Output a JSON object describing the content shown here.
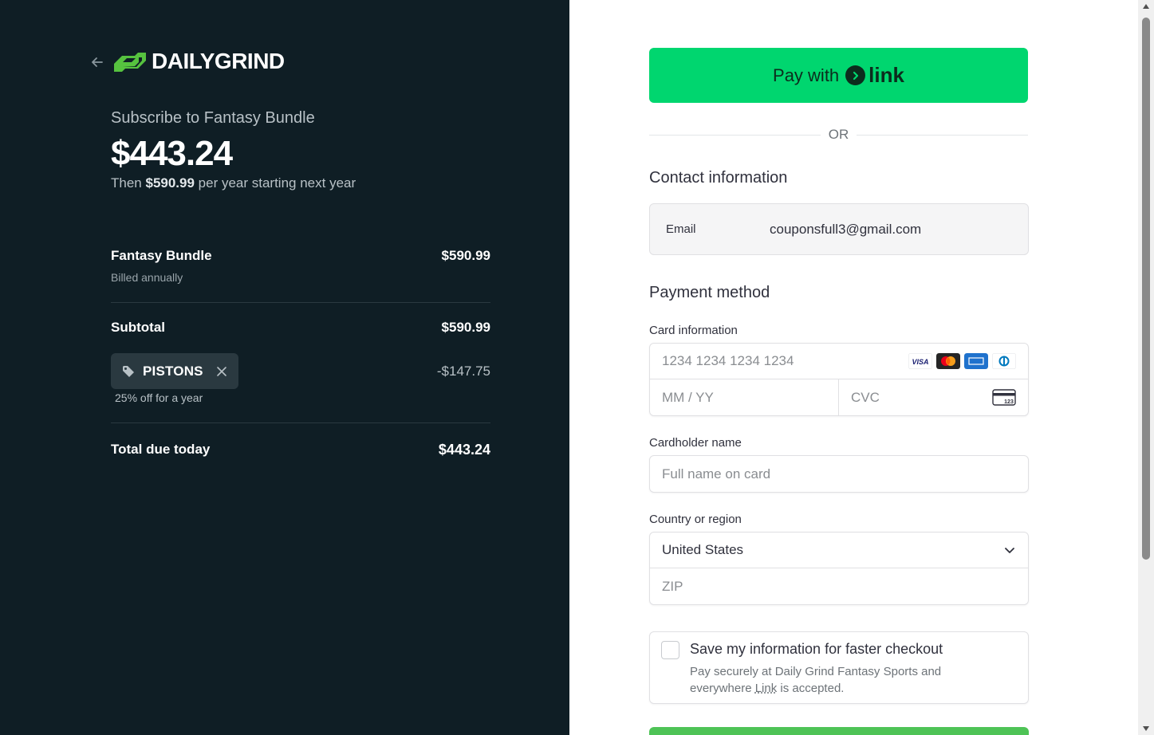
{
  "brand": {
    "name": "DAILYGRIND",
    "color": "#56c23f"
  },
  "summary": {
    "subscribe_label": "Subscribe to Fantasy Bundle",
    "price": "$443.24",
    "then_prefix": "Then ",
    "then_amount": "$590.99",
    "then_suffix": " per year starting next year"
  },
  "line_items": {
    "product_name": "Fantasy Bundle",
    "product_price": "$590.99",
    "billing": "Billed annually",
    "subtotal_label": "Subtotal",
    "subtotal_value": "$590.99",
    "promo_code": "PISTONS",
    "discount_value": "-$147.75",
    "discount_note": "25% off for a year",
    "total_label": "Total due today",
    "total_value": "$443.24"
  },
  "checkout": {
    "link_pay_prefix": "Pay with",
    "link_word": "link",
    "or_text": "OR",
    "contact_heading": "Contact information",
    "email_label": "Email",
    "email_value": "couponsfull3@gmail.com",
    "payment_heading": "Payment method",
    "card_label": "Card information",
    "card_number_placeholder": "1234 1234 1234 1234",
    "expiry_placeholder": "MM / YY",
    "cvc_placeholder": "CVC",
    "cvc_icon_text": "123",
    "card_brands": [
      "visa-icon",
      "mastercard-icon",
      "amex-icon",
      "diners-icon"
    ],
    "visa_text": "VISA",
    "cardholder_label": "Cardholder name",
    "cardholder_placeholder": "Full name on card",
    "country_label": "Country or region",
    "country_value": "United States",
    "zip_placeholder": "ZIP",
    "save_title": "Save my information for faster checkout",
    "save_desc_pre": "Pay securely at Daily Grind Fantasy Sports and everywhere ",
    "save_desc_link": "Link",
    "save_desc_post": " is accepted."
  },
  "colors": {
    "left_bg": "#0f1e25",
    "link_green": "#00d66f",
    "pay_button": "#4ec356"
  }
}
